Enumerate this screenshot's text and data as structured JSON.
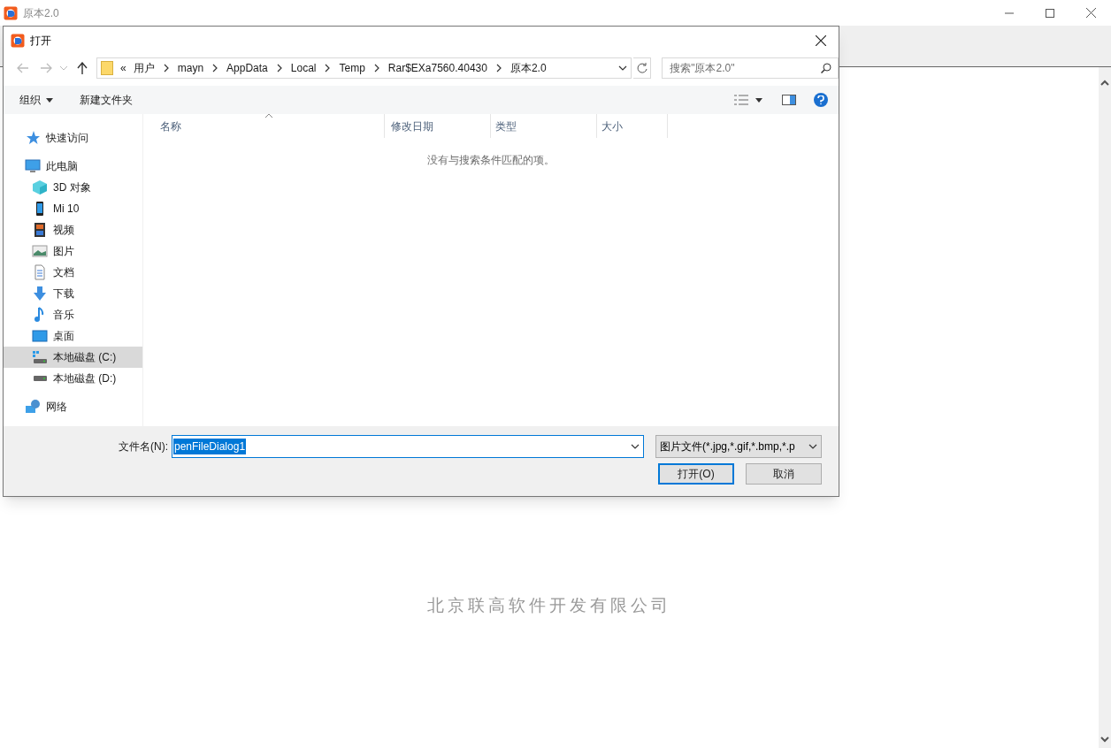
{
  "app_window": {
    "title": "原本2.0",
    "footer": "北京联高软件开发有限公司"
  },
  "dialog": {
    "title": "打开",
    "address": {
      "overflow": "«",
      "crumbs": [
        "用户",
        "mayn",
        "AppData",
        "Local",
        "Temp",
        "Rar$EXa7560.40430",
        "原本2.0"
      ]
    },
    "search": {
      "placeholder": "搜索\"原本2.0\""
    },
    "toolbar": {
      "organize": "组织",
      "new_folder": "新建文件夹"
    },
    "sidebar": [
      {
        "label": "快速访问",
        "selected": false
      },
      {
        "label": "此电脑",
        "selected": false,
        "children": [
          {
            "label": "3D 对象",
            "selected": false
          },
          {
            "label": "Mi 10",
            "selected": false
          },
          {
            "label": "视频",
            "selected": false
          },
          {
            "label": "图片",
            "selected": false
          },
          {
            "label": "文档",
            "selected": false
          },
          {
            "label": "下载",
            "selected": false
          },
          {
            "label": "音乐",
            "selected": false
          },
          {
            "label": "桌面",
            "selected": false
          },
          {
            "label": "本地磁盘 (C:)",
            "selected": true
          },
          {
            "label": "本地磁盘 (D:)",
            "selected": false
          }
        ]
      },
      {
        "label": "网络",
        "selected": false
      }
    ],
    "columns": [
      "名称",
      "修改日期",
      "类型",
      "大小"
    ],
    "empty_message": "没有与搜索条件匹配的项。",
    "filename": {
      "label": "文件名(N):",
      "value": "penFileDialog1",
      "text_selected": true
    },
    "file_type": "图片文件(*.jpg,*.gif,*.bmp,*.p",
    "buttons": [
      {
        "label": "打开(O)",
        "default": true
      },
      {
        "label": "取消",
        "default": false
      }
    ]
  }
}
